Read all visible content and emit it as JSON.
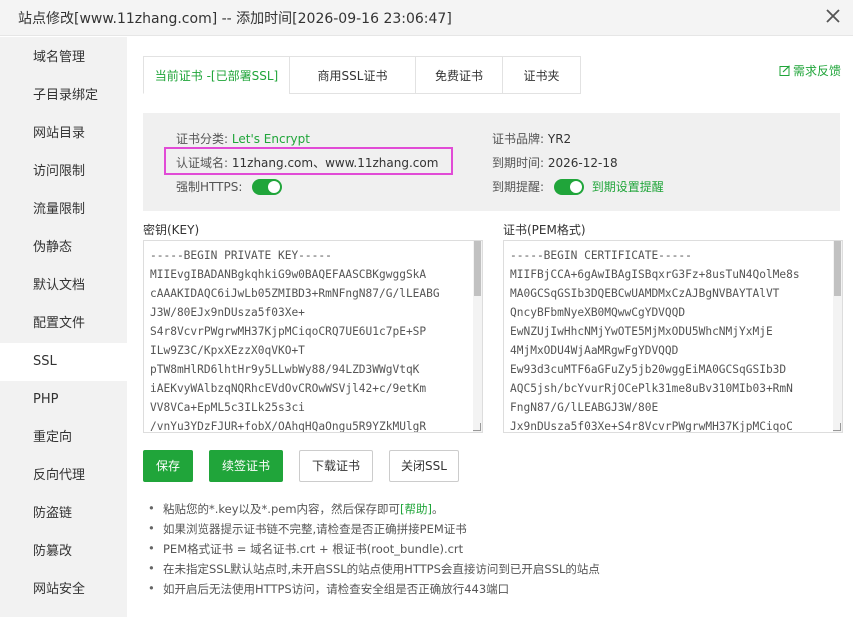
{
  "dialog": {
    "title": "站点修改[www.11zhang.com] -- 添加时间[2026-09-16 23:06:47]"
  },
  "sidebar": {
    "items": [
      {
        "label": "域名管理"
      },
      {
        "label": "子目录绑定"
      },
      {
        "label": "网站目录"
      },
      {
        "label": "访问限制"
      },
      {
        "label": "流量限制"
      },
      {
        "label": "伪静态"
      },
      {
        "label": "默认文档"
      },
      {
        "label": "配置文件"
      },
      {
        "label": "SSL"
      },
      {
        "label": "PHP"
      },
      {
        "label": "重定向"
      },
      {
        "label": "反向代理"
      },
      {
        "label": "防盗链"
      },
      {
        "label": "防篡改"
      },
      {
        "label": "网站安全"
      }
    ],
    "active": "SSL"
  },
  "tabs": [
    {
      "label": "当前证书 -[已部署SSL]",
      "active": true
    },
    {
      "label": "商用SSL证书",
      "active": false
    },
    {
      "label": "免费证书",
      "active": false
    },
    {
      "label": "证书夹",
      "active": false
    }
  ],
  "feedback_label": "需求反馈",
  "cert_info": {
    "type_label": "证书分类:",
    "type_value": "Let's Encrypt",
    "domain_label": "认证域名:",
    "domain_value": "11zhang.com、www.11zhang.com",
    "https_label": "强制HTTPS:",
    "https_enabled": true,
    "brand_label": "证书品牌:",
    "brand_value": "YR2",
    "expire_label": "到期时间:",
    "expire_value": "2026-12-18",
    "remind_label": "到期提醒:",
    "remind_enabled": true,
    "remind_text": "到期设置提醒"
  },
  "key_field": {
    "label": "密钥(KEY)",
    "value": "-----BEGIN PRIVATE KEY-----\nMIIEvgIBADANBgkqhkiG9w0BAQEFAASCBKgwggSkA\ncAAAKIDAQC6iJwLb05ZMIBD3+RmNFngN87/G/lLEABG\nJ3W/80EJx9nDUsza5f03Xe+\nS4r8VcvrPWgrwMH37KjpMCiqoCRQ7UE6U1c7pE+SP\nILw9Z3C/KpxXEzzX0qVKO+T\npTW8mHlRD6lhtHr9y5LLwbWy88/94LZD3WWgVtqK\niAEKvyWAlbzqNQRhcEVdOvCROwWSVjl42+c/9etKm\nVV8VCa+EpML5c3ILk25s3ci\n/vnYu3YDzFJUR+fobX/OAhqHQaOngu5R9YZkMUlgR"
  },
  "cert_field": {
    "label": "证书(PEM格式)",
    "value": "-----BEGIN CERTIFICATE-----\nMIIFBjCCA+6gAwIBAgISBqxrG3Fz+8usTuN4QolMe8s\nMA0GCSqGSIb3DQEBCwUAMDMxCzAJBgNVBAYTAlVT\nQncyBFbmNyeXB0MQwwCgYDVQQD\nEwNZUjIwHhcNMjYwOTE5MjMxODU5WhcNMjYxMjE\n4MjMxODU4WjAaMRgwFgYDVQQD\nEw93d3cuMTF6aGFuZy5jb20wggEiMA0GCSqGSIb3D\nAQC5jsh/bcYvurRjOCePlk31me8uBv310MIb03+RmN\nFngN87/G/lLEABGJ3W/80E\nJx9nDUsza5f03Xe+S4r8VcvrPWgrwMH37KjpMCiqoC"
  },
  "buttons": {
    "save": "保存",
    "renew": "续签证书",
    "download": "下载证书",
    "close_ssl": "关闭SSL"
  },
  "notes": [
    {
      "text": "粘贴您的*.key以及*.pem内容，然后保存即可",
      "link": "[帮助]",
      "suffix": "。"
    },
    {
      "text": "如果浏览器提示证书链不完整,请检查是否正确拼接PEM证书"
    },
    {
      "text": "PEM格式证书 = 域名证书.crt + 根证书(root_bundle).crt"
    },
    {
      "text": "在未指定SSL默认站点时,未开启SSL的站点使用HTTPS会直接访问到已开启SSL的站点"
    },
    {
      "text": "如开启后无法使用HTTPS访问，请检查安全组是否正确放行443端口"
    }
  ],
  "colors": {
    "accent": "#20a53a",
    "highlight_border": "#e14bd6",
    "sidebar_bg": "#f2f2f2",
    "infobox_bg": "#f0f0f0"
  }
}
